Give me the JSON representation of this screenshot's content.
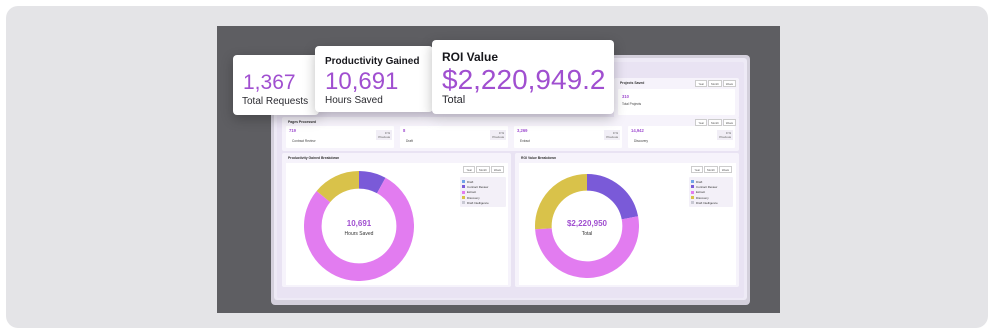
{
  "kpis": {
    "requests": {
      "value": "1,367",
      "caption": "Total Requests"
    },
    "productivity": {
      "heading": "Productivity Gained",
      "value": "10,691",
      "caption": "Hours Saved"
    },
    "roi": {
      "heading": "ROI Value",
      "value": "$2,220,949.2",
      "caption": "Total"
    }
  },
  "projects_panel": {
    "title": "Projects Saved",
    "value": "310",
    "caption": "Total Projects",
    "range": [
      "Year",
      "Month",
      "Week"
    ]
  },
  "pages_panel": {
    "title": "Pages Processed",
    "range": [
      "Year",
      "Month",
      "Week"
    ],
    "items": [
      {
        "value": "719",
        "label": "Contract Review",
        "prev": "0 %",
        "prev_label": "Previous"
      },
      {
        "value": "8",
        "label": "Draft",
        "prev": "0 %",
        "prev_label": "Previous"
      },
      {
        "value": "3,269",
        "label": "Extract",
        "prev": "0 %",
        "prev_label": "Previous"
      },
      {
        "value": "14,942",
        "label": "Discovery",
        "prev": "0 %",
        "prev_label": "Previous"
      }
    ]
  },
  "left_chart": {
    "title": "Productivity Gained Breakdown",
    "range": [
      "Year",
      "Month",
      "Week"
    ],
    "center_value": "10,691",
    "center_caption": "Hours Saved",
    "legend": [
      "Draft",
      "Contract Review",
      "Extract",
      "Discovery",
      "Draft Intelligence"
    ]
  },
  "right_chart": {
    "title": "ROI Value Breakdown",
    "range": [
      "Year",
      "Month",
      "Week"
    ],
    "center_value": "$2,220,950",
    "center_caption": "Total",
    "legend": [
      "Draft",
      "Contract Review",
      "Extract",
      "Discovery",
      "Draft Intelligence"
    ]
  },
  "colors": {
    "accent": "#a04fd0",
    "draft": "#6fa3e8",
    "contract_review": "#7a5ad8",
    "extract": "#e27cf0",
    "discovery": "#d9c24a",
    "draft_intelligence": "#c9c9d4"
  },
  "chart_data": [
    {
      "type": "pie",
      "title": "Productivity Gained Breakdown",
      "categories": [
        "Contract Review",
        "Extract",
        "Discovery"
      ],
      "values": [
        8,
        78,
        14
      ]
    },
    {
      "type": "pie",
      "title": "ROI Value Breakdown",
      "categories": [
        "Contract Review",
        "Extract",
        "Discovery"
      ],
      "values": [
        22,
        52,
        26
      ]
    }
  ]
}
